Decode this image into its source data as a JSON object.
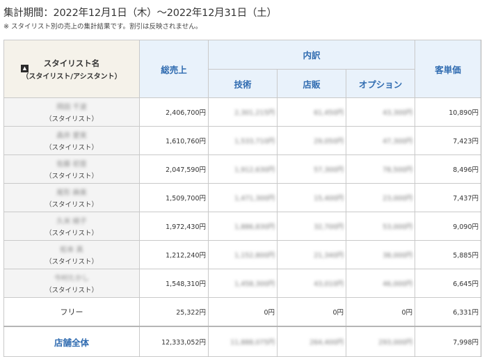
{
  "header": {
    "period": "集計期間：2022年12月1日（木）〜2022年12月31日（土）",
    "note": "※ スタイリスト別の売上の集計結果です。割引は反映されません。"
  },
  "table": {
    "col_stylist_line1": "スタイリスト名",
    "col_stylist_line2": "（スタイリスト/アシスタント）",
    "col_total": "総売上",
    "col_breakdown": "内訳",
    "col_tech": "技術",
    "col_retail": "店販",
    "col_option": "オプション",
    "col_unit_price": "客単価",
    "sort_icon": "sort-up-icon",
    "rows": [
      {
        "name": "岡田 千波",
        "role": "（スタイリスト）",
        "total": "2,406,700円",
        "tech": "2,301,215円",
        "retail": "61,450円",
        "option": "43,300円",
        "unit": "10,890円"
      },
      {
        "name": "森井 愛実",
        "role": "（スタイリスト）",
        "total": "1,610,760円",
        "tech": "1,533,710円",
        "retail": "29,050円",
        "option": "47,300円",
        "unit": "7,423円"
      },
      {
        "name": "佐藤 初音",
        "role": "（スタイリスト）",
        "total": "2,047,590円",
        "tech": "1,912,630円",
        "retail": "57,300円",
        "option": "78,500円",
        "unit": "8,496円"
      },
      {
        "name": "尾形 麻美",
        "role": "（スタイリスト）",
        "total": "1,509,700円",
        "tech": "1,471,300円",
        "retail": "15,400円",
        "option": "23,000円",
        "unit": "7,437円"
      },
      {
        "name": "久米 綾子",
        "role": "（スタイリスト）",
        "total": "1,972,430円",
        "tech": "1,886,830円",
        "retail": "32,700円",
        "option": "53,000円",
        "unit": "9,090円"
      },
      {
        "name": "松本 真",
        "role": "（スタイリスト）",
        "total": "1,212,240円",
        "tech": "1,152,800円",
        "retail": "21,340円",
        "option": "38,000円",
        "unit": "5,885円"
      },
      {
        "name": "今村たかし",
        "role": "（スタイリスト）",
        "total": "1,548,310円",
        "tech": "1,458,300円",
        "retail": "43,010円",
        "option": "46,000円",
        "unit": "6,645円"
      }
    ],
    "free_row": {
      "label": "フリー",
      "total": "25,322円",
      "tech": "0円",
      "retail": "0円",
      "option": "0円",
      "unit": "6,331円"
    },
    "total_row": {
      "label": "店舗全体",
      "total": "12,333,052円",
      "tech": "11,888,075円",
      "retail": "264,400円",
      "option": "293,000円",
      "unit": "7,998円"
    }
  }
}
